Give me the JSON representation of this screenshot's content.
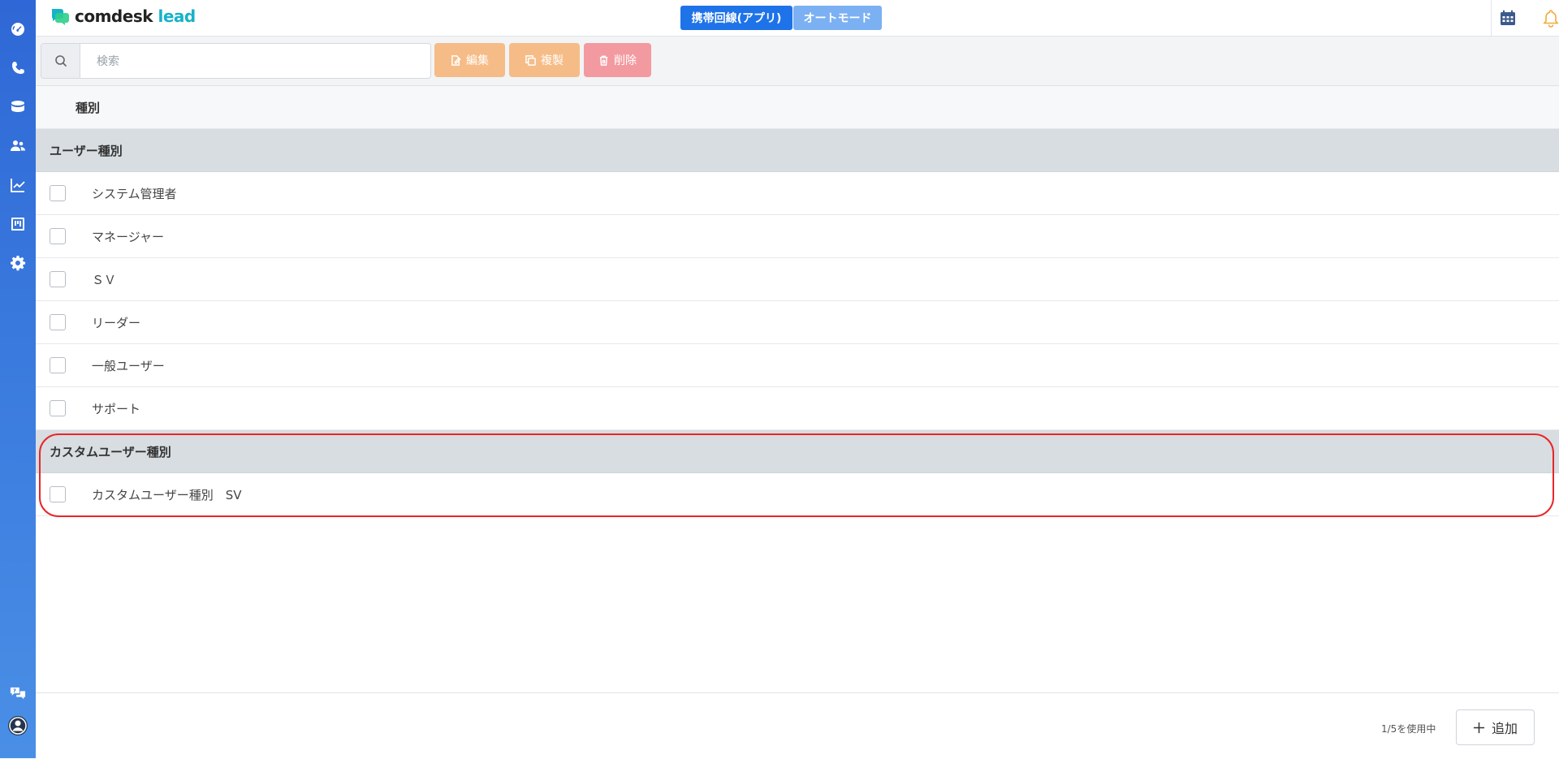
{
  "app": {
    "logo_main": "comdesk",
    "logo_accent": "lead"
  },
  "sidebar": {
    "items": [
      {
        "icon": "dashboard-icon"
      },
      {
        "icon": "phone-icon"
      },
      {
        "icon": "database-icon"
      },
      {
        "icon": "users-icon"
      },
      {
        "icon": "chart-icon"
      },
      {
        "icon": "board-icon"
      },
      {
        "icon": "gear-icon"
      }
    ],
    "bottom": [
      {
        "icon": "help-chat-icon"
      },
      {
        "icon": "profile-icon"
      }
    ]
  },
  "header": {
    "mobile_line_label": "携帯回線(アプリ)",
    "auto_mode_label": "オートモード"
  },
  "toolbar": {
    "search_placeholder": "検索",
    "edit_label": "編集",
    "copy_label": "複製",
    "delete_label": "削除"
  },
  "table": {
    "column_header": "種別",
    "groups": [
      {
        "title": "ユーザー種別",
        "rows": [
          "システム管理者",
          "マネージャー",
          "ＳＶ",
          "リーダー",
          "一般ユーザー",
          "サポート"
        ]
      },
      {
        "title": "カスタムユーザー種別",
        "rows": [
          "カスタムユーザー種別　SV"
        ]
      }
    ]
  },
  "footer": {
    "usage_text": "1/5を使用中",
    "add_label": "追加"
  },
  "colors": {
    "primary": "#1f73e8",
    "auto_mode": "#7bb0f3",
    "edit_copy": "#f6bc87",
    "delete": "#f39aa0",
    "highlight": "#e8262a",
    "logo_accent": "#16b2c9"
  }
}
